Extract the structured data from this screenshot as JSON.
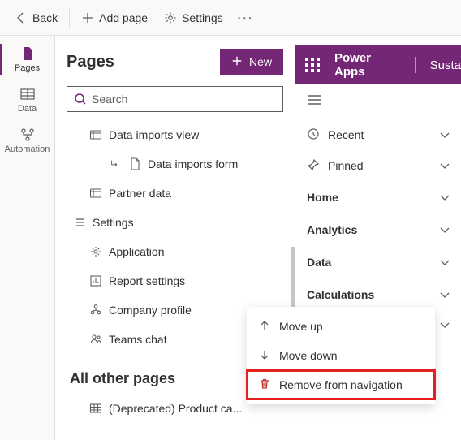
{
  "cmdbar": {
    "back": "Back",
    "add_page": "Add page",
    "settings": "Settings"
  },
  "rail": {
    "pages": "Pages",
    "data": "Data",
    "automation": "Automation"
  },
  "panel": {
    "title": "Pages",
    "new_label": "New",
    "search_placeholder": "Search",
    "groups": {
      "settings": "Settings",
      "other": "All other pages"
    },
    "items": {
      "data_imports_view": "Data imports view",
      "data_imports_form": "Data imports form",
      "partner_data": "Partner data",
      "application": "Application",
      "report_settings": "Report settings",
      "company_profile": "Company profile",
      "teams_chat": "Teams chat",
      "deprecated_product": "(Deprecated) Product ca..."
    }
  },
  "preview": {
    "brand": "Power Apps",
    "appname": "Susta",
    "nav": {
      "recent": "Recent",
      "pinned": "Pinned",
      "home": "Home",
      "analytics": "Analytics",
      "data": "Data",
      "calculations": "Calculations"
    }
  },
  "context_menu": {
    "move_up": "Move up",
    "move_down": "Move down",
    "remove": "Remove from navigation"
  }
}
